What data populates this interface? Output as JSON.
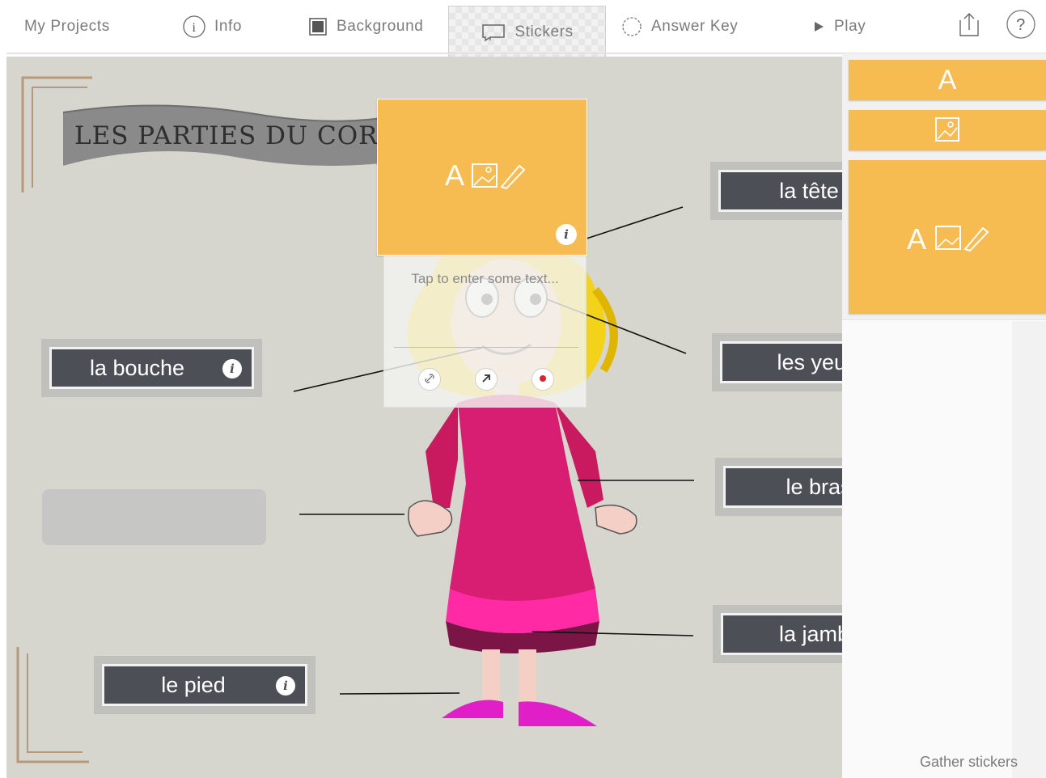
{
  "toolbar": {
    "my_projects": "My Projects",
    "info": "Info",
    "background": "Background",
    "stickers": "Stickers",
    "answer_key": "Answer Key",
    "play": "Play",
    "active_tab": "Stickers"
  },
  "canvas": {
    "title": "LES PARTIES DU CORPS",
    "labels": {
      "bouche": "la bouche",
      "pied": "le pied",
      "tete": "la tête",
      "yeux": "les yeux",
      "bras": "le bras",
      "jambe": "la jambe"
    },
    "info_glyph": "i"
  },
  "selected_sticker": {
    "glyphs": "A 🖼 ✎",
    "info_glyph": "i"
  },
  "text_popup": {
    "placeholder": "Tap to enter some text..."
  },
  "panel": {
    "sticker_text_glyph": "A",
    "gather_label": "Gather stickers"
  },
  "colors": {
    "sticker": "#f6bb51",
    "label_bg": "#4d4f56",
    "canvas_bg": "#d6d5ce",
    "accent_frame": "#b89a78"
  }
}
